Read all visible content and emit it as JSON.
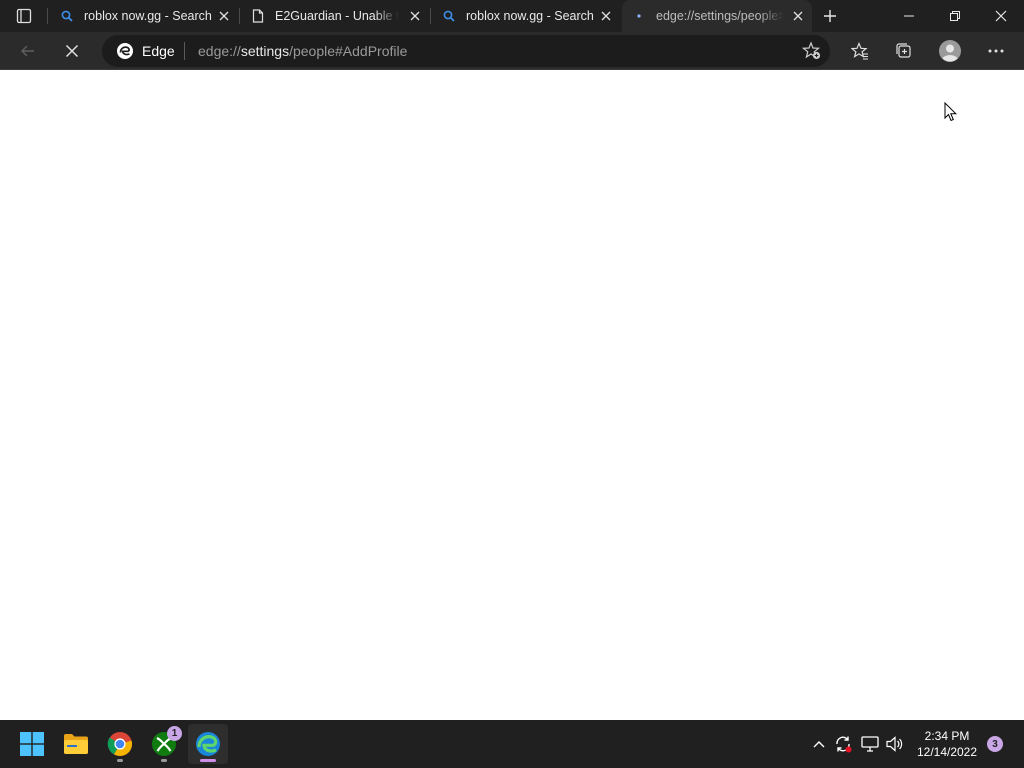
{
  "browser": {
    "tabs": [
      {
        "title": "roblox now.gg - Search",
        "favicon": "search-icon",
        "active": false
      },
      {
        "title": "E2Guardian - Unable to",
        "favicon": "page-icon",
        "active": false
      },
      {
        "title": "roblox now.gg - Search",
        "favicon": "search-icon",
        "active": false
      },
      {
        "title": "edge://settings/people#",
        "favicon": "loading-dot-icon",
        "active": true
      }
    ],
    "address": {
      "chip_label": "Edge",
      "url_scheme": "edge://",
      "url_host": "settings",
      "url_path": "/people#AddProfile"
    }
  },
  "taskbar": {
    "apps": [
      {
        "name": "start-button"
      },
      {
        "name": "file-explorer"
      },
      {
        "name": "chrome"
      },
      {
        "name": "xbox",
        "badge": "1"
      },
      {
        "name": "edge",
        "active": true
      }
    ],
    "clock": {
      "time": "2:34 PM",
      "date": "12/14/2022"
    },
    "notification_count": "3"
  },
  "colors": {
    "titlebar": "#202020",
    "toolbar": "#2b2b2b",
    "address_bg": "#1c1c1c",
    "accent": "#d28de8"
  }
}
